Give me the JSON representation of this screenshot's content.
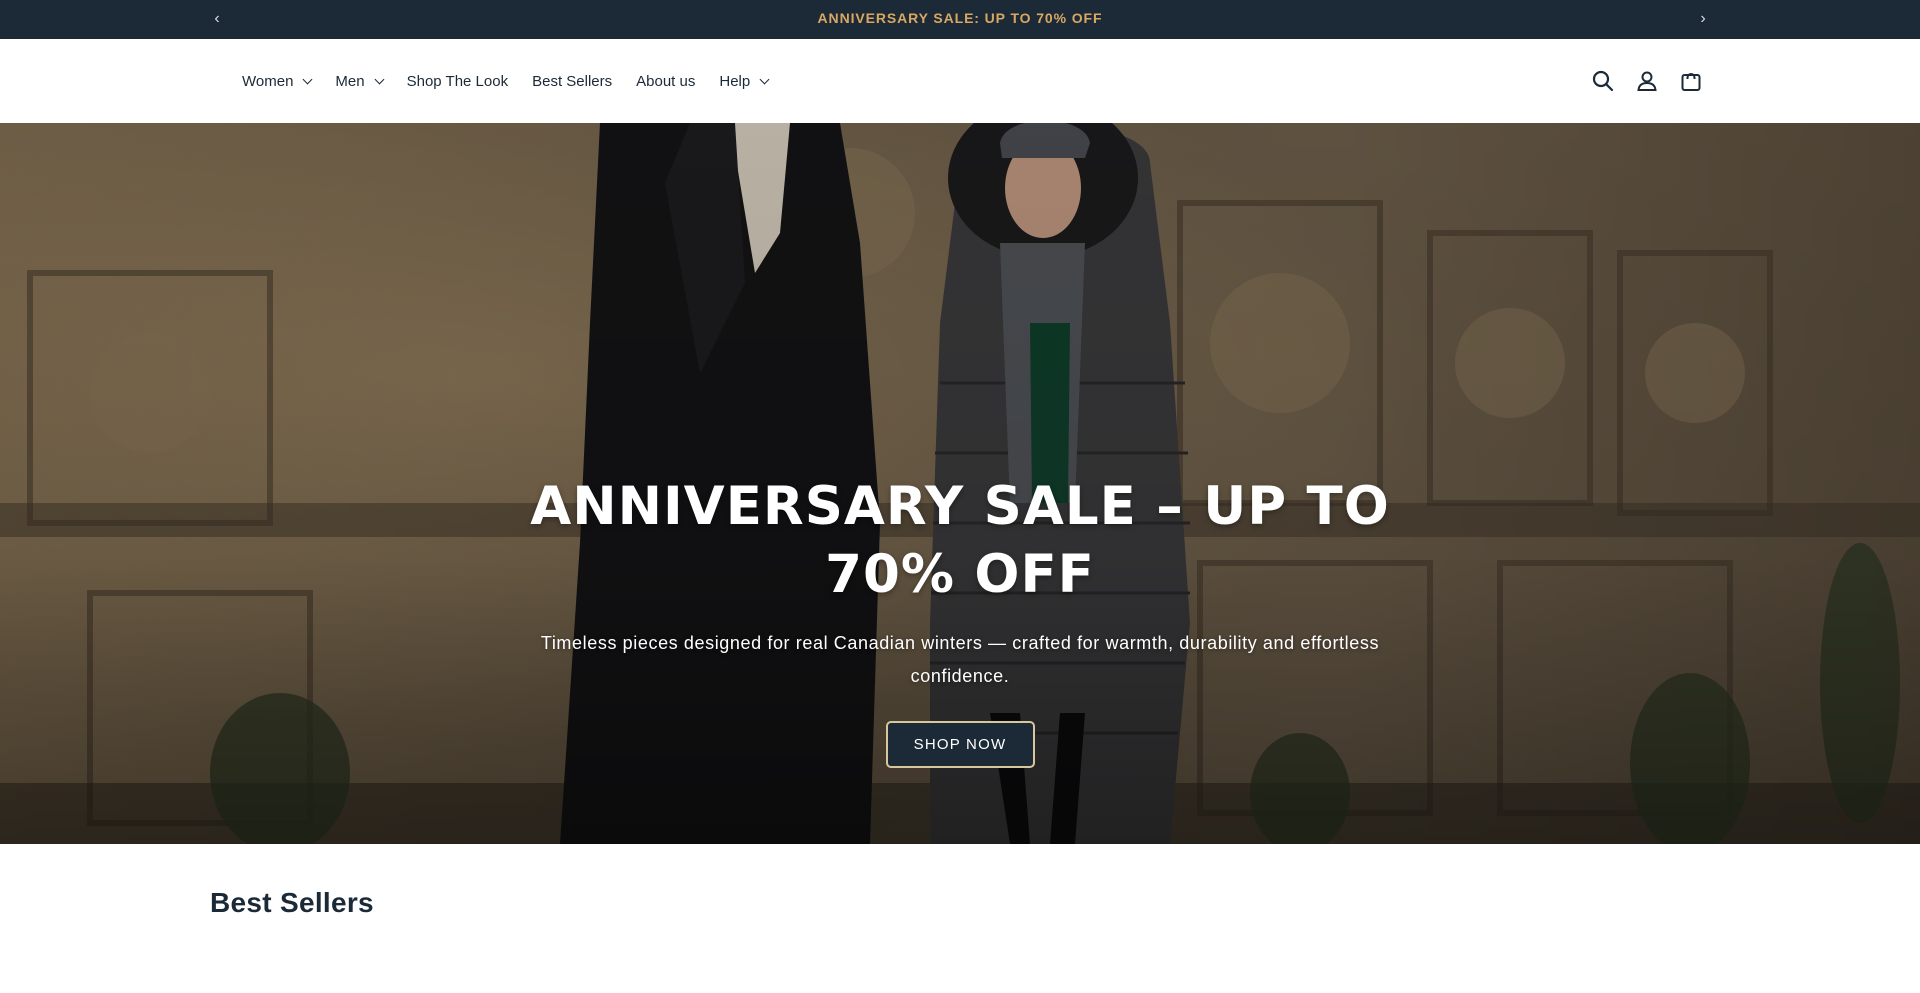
{
  "announcement": {
    "message": "ANNIVERSARY SALE: UP TO 70% OFF",
    "prev_icon": "chevron-left-icon",
    "next_icon": "chevron-right-icon",
    "background": "#1c2a38",
    "text_color": "#d8a862"
  },
  "nav": {
    "items": [
      {
        "label": "Women",
        "has_dropdown": true
      },
      {
        "label": "Men",
        "has_dropdown": true
      },
      {
        "label": "Shop The Look",
        "has_dropdown": false
      },
      {
        "label": "Best Sellers",
        "has_dropdown": false
      },
      {
        "label": "About us",
        "has_dropdown": false
      },
      {
        "label": "Help",
        "has_dropdown": true
      }
    ]
  },
  "header_icons": [
    "search-icon",
    "account-icon",
    "cart-icon"
  ],
  "hero": {
    "heading": "ANNIVERSARY SALE – UP TO 70% OFF",
    "subheading": "Timeless pieces designed for real Canadian winters — crafted for warmth, durability and effortless confidence.",
    "cta_label": "SHOP NOW",
    "cta_background": "#1c2a38",
    "cta_border": "#d8c79a"
  },
  "best_sellers": {
    "title": "Best Sellers"
  }
}
